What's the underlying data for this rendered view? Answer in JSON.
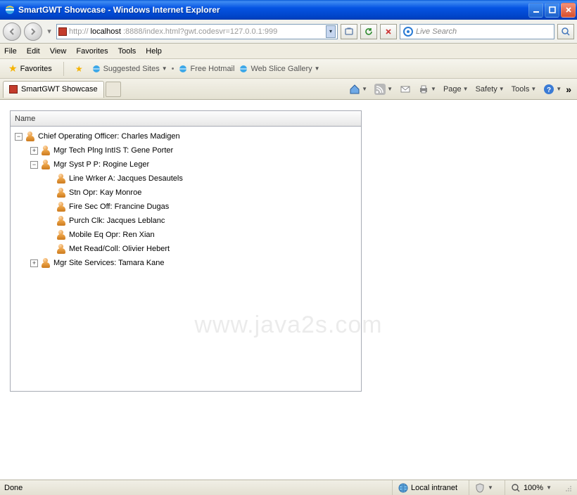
{
  "window": {
    "title": "SmartGWT Showcase - Windows Internet Explorer"
  },
  "nav": {
    "url_prefix": "http://",
    "url_host": "localhost",
    "url_rest": ":8888/index.html?gwt.codesvr=127.0.0.1:999",
    "search_placeholder": "Live Search"
  },
  "menu": {
    "file": "File",
    "edit": "Edit",
    "view": "View",
    "favorites": "Favorites",
    "tools": "Tools",
    "help": "Help"
  },
  "favbar": {
    "favorites": "Favorites",
    "suggested": "Suggested Sites",
    "hotmail": "Free Hotmail",
    "webslice": "Web Slice Gallery"
  },
  "tab": {
    "title": "SmartGWT Showcase"
  },
  "cmdbar": {
    "page": "Page",
    "safety": "Safety",
    "tools": "Tools"
  },
  "tree": {
    "header": "Name",
    "root": "Chief Operating Officer: Charles Madigen",
    "n1": "Mgr Tech Plng IntIS T: Gene Porter",
    "n2": "Mgr Syst P P: Rogine Leger",
    "n2a": "Line Wrker A: Jacques Desautels",
    "n2b": "Stn Opr: Kay Monroe",
    "n2c": "Fire Sec Off: Francine Dugas",
    "n2d": "Purch Clk: Jacques Leblanc",
    "n2e": "Mobile Eq Opr: Ren Xian",
    "n2f": "Met Read/Coll: Olivier Hebert",
    "n3": "Mgr Site Services: Tamara Kane"
  },
  "watermark": "www.java2s.com",
  "status": {
    "done": "Done",
    "zone": "Local intranet",
    "zoom": "100%"
  }
}
